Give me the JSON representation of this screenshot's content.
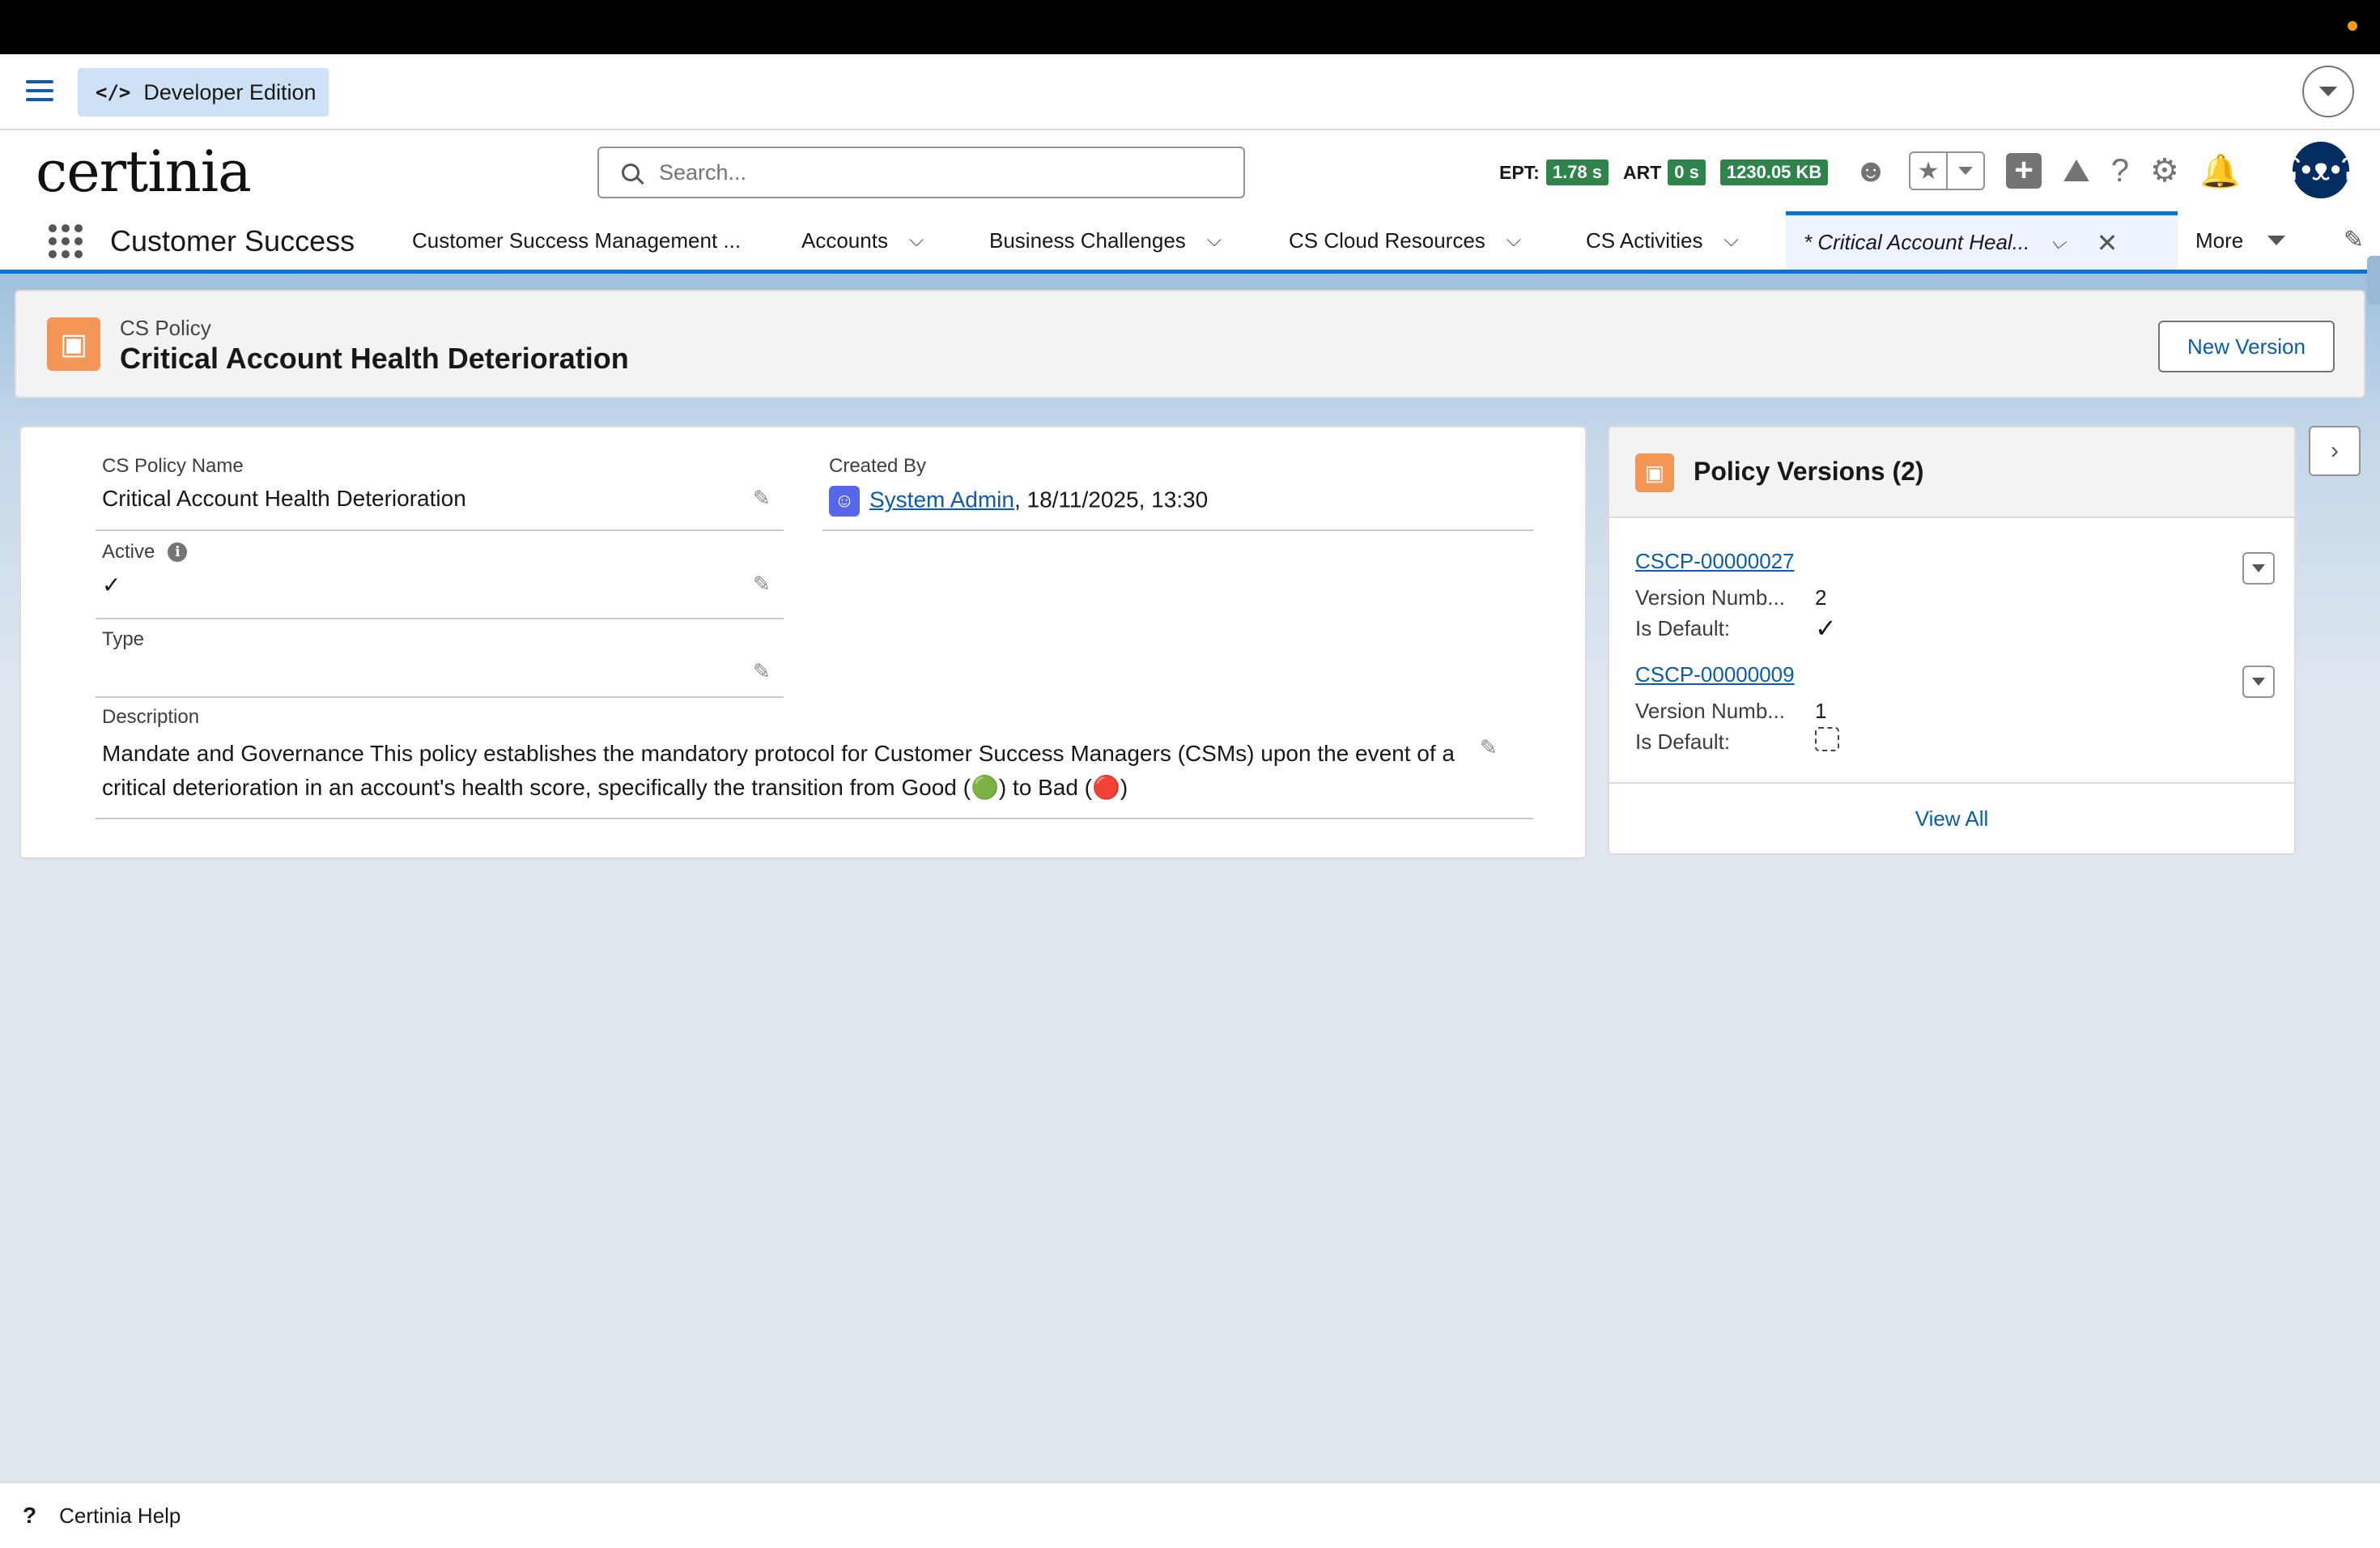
{
  "dev_bar": {
    "edition_label": "Developer Edition",
    "edition_icon": "code-icon"
  },
  "header": {
    "logo_text": "certinia",
    "search_placeholder": "Search...",
    "perf": [
      {
        "label": "EPT:",
        "value": "1.78 s"
      },
      {
        "label": "ART",
        "value": "0 s"
      },
      {
        "label": "",
        "value": "1230.05 KB"
      }
    ],
    "icons": [
      "agent-icon",
      "favorites-star-icon",
      "favorites-dropdown-icon",
      "global-create-icon",
      "trailhead-icon",
      "help-icon",
      "setup-gear-icon",
      "notifications-bell-icon",
      "user-avatar"
    ]
  },
  "nav": {
    "app_name": "Customer Success",
    "tabs": [
      {
        "label": "Customer Success Management ...",
        "has_menu": false
      },
      {
        "label": "Accounts",
        "has_menu": true
      },
      {
        "label": "Business Challenges",
        "has_menu": true
      },
      {
        "label": "CS Cloud Resources",
        "has_menu": true
      },
      {
        "label": "CS Activities",
        "has_menu": true
      },
      {
        "label": "* Critical Account Heal...",
        "has_menu": true,
        "active": true
      }
    ],
    "more_label": "More"
  },
  "record": {
    "object_type": "CS Policy",
    "title": "Critical Account Health Deterioration",
    "new_version_label": "New Version"
  },
  "details": {
    "policy_name_label": "CS Policy Name",
    "policy_name_value": "Critical Account Health Deterioration",
    "active_label": "Active",
    "active_value": "✓",
    "type_label": "Type",
    "type_value": "",
    "created_by_label": "Created By",
    "created_by_user": "System Admin",
    "created_by_date": ", 18/11/2025, 13:30",
    "description_label": "Description",
    "description_value": "Mandate and Governance This policy establishes the mandatory protocol for Customer Success Managers (CSMs) upon the event of a critical deterioration in an account's health score, specifically the transition from Good (🟢) to Bad (🔴)"
  },
  "related": {
    "title": "Policy Versions (2)",
    "items": [
      {
        "name": "CSCP-00000027",
        "version_label": "Version Numb...",
        "version_value": "2",
        "default_label": "Is Default:",
        "is_default": true
      },
      {
        "name": "CSCP-00000009",
        "version_label": "Version Numb...",
        "version_value": "1",
        "default_label": "Is Default:",
        "is_default": false
      }
    ],
    "view_all_label": "View All"
  },
  "footer": {
    "help_label": "Certinia Help"
  },
  "colors": {
    "brand_blue": "#0176d3",
    "link_blue": "#0b5cab",
    "object_orange": "#f49756",
    "perf_green": "#2e844a"
  }
}
